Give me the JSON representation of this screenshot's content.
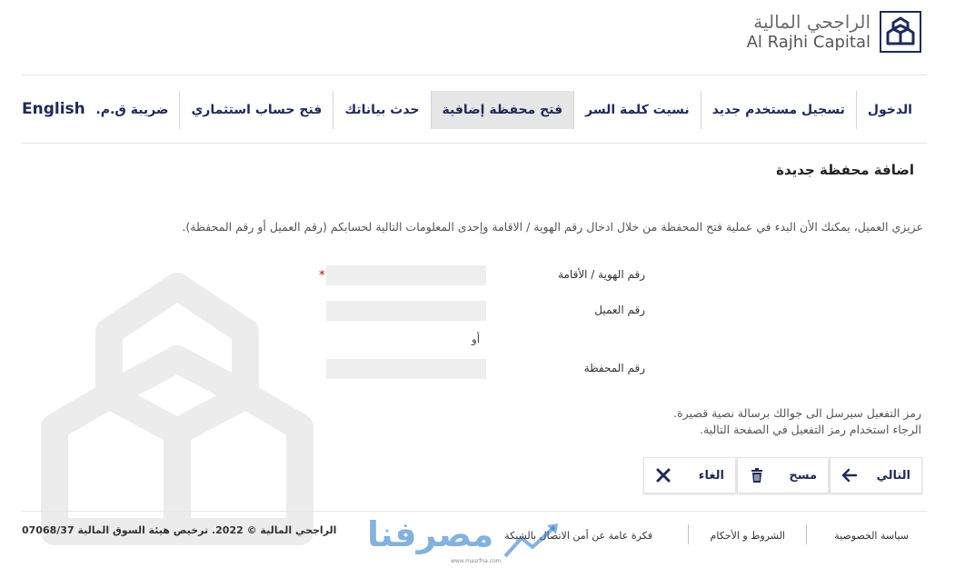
{
  "header": {
    "brand_ar": "الراجحي المالية",
    "brand_en": "Al Rajhi Capital"
  },
  "nav": {
    "english": "English",
    "items": [
      {
        "label": "الدخول",
        "active": false
      },
      {
        "label": "تسجيل مستخدم جديد",
        "active": false
      },
      {
        "label": "نسيت كلمة السر",
        "active": false
      },
      {
        "label": "فتح محفظة إضافية",
        "active": true
      },
      {
        "label": "حدث بياناتك",
        "active": false
      },
      {
        "label": "فتح حساب استثماري",
        "active": false
      },
      {
        "label": "ضريبة ق.م.",
        "active": false
      }
    ]
  },
  "page": {
    "title": "اضافة محفظة جديدة",
    "intro": "عزيزي العميل، يمكنك الأن البدء في عملية فتح المحفظة من خلال ادخال رقم الهوية / الاقامة وإحدى المعلومات التالية لحسابكم (رقم العميل أو رقم المحفظة)."
  },
  "form": {
    "id_label": "رقم الهوية / الأقامة",
    "id_value": "",
    "required_mark": "*",
    "client_label": "رقم العميل",
    "client_value": "",
    "or_text": "أو",
    "portfolio_label": "رقم المحفظة",
    "portfolio_value": ""
  },
  "activation": {
    "line1": "رمز التفعيل سيرسل الى جوالك برسالة نصية قصيرة.",
    "line2": "الرجاء استخدام رمز التفعيل في الصفحة التالية."
  },
  "buttons": {
    "next": "التالي",
    "clear": "مسح",
    "cancel": "الغاء"
  },
  "footer": {
    "privacy": "سياسة الخصوصية",
    "terms": "الشروط و الأحكام",
    "security": "فكرة عامة عن أمن الاتصال بالشبكة",
    "copyright": "الراجحي المالية © 2022. ترخيص هيئة السوق المالية 07068/37"
  },
  "overlay": {
    "text": "مصرفنا",
    "url": "www.masrfna.com"
  },
  "colors": {
    "nav_text": "#1e2a5a",
    "active_tab": "#e6e6e6",
    "field_bg": "#eeeeee",
    "required": "#c40000"
  }
}
